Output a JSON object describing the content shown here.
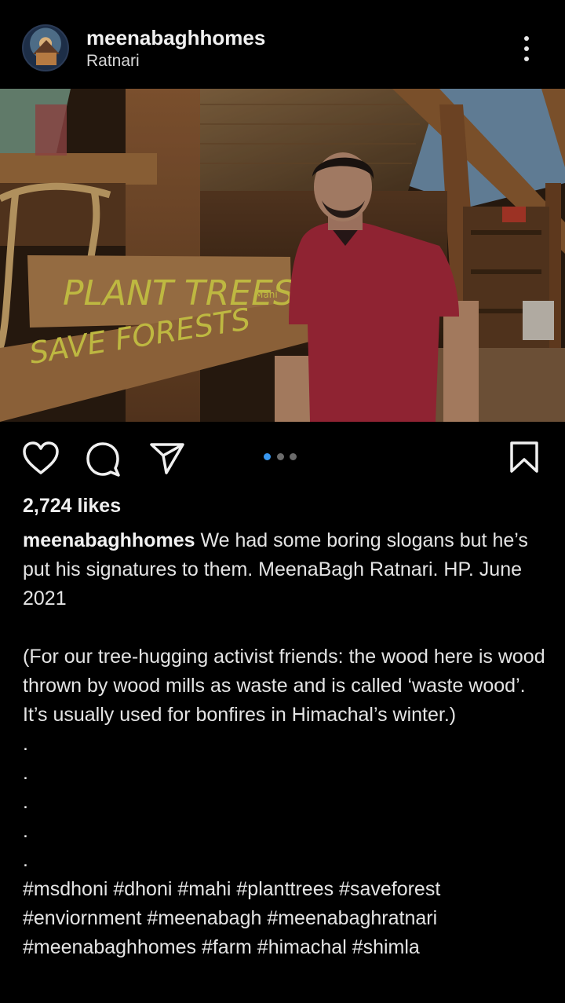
{
  "header": {
    "username": "meenabaghhomes",
    "location": "Ratnari"
  },
  "photo": {
    "sign_line1": "PLANT TREES",
    "sign_line2": "SAVE FORESTS",
    "signature": "Mahi"
  },
  "actions": {
    "like_icon": "heart-icon",
    "comment_icon": "comment-icon",
    "share_icon": "send-icon",
    "save_icon": "bookmark-icon",
    "carousel_count": 3,
    "carousel_active_index": 0
  },
  "post": {
    "likes": "2,724 likes",
    "caption_user": "meenabaghhomes",
    "caption_line1": " We had  some boring slogans but he’s put his signatures to them. MeenaBagh Ratnari. HP. June 2021",
    "caption_para2": "(For our tree-hugging activist friends: the wood here is wood thrown by wood mills as waste and is called ‘waste wood’. It’s usually used for bonfires in Himachal’s winter.)",
    "dot": ".",
    "hashtags": "#msdhoni #dhoni #mahi #planttrees #saveforest #enviornment #meenabagh #meenabaghratnari #meenabaghhomes #farm #himachal #shimla"
  },
  "colors": {
    "background": "#000000",
    "accent": "#3897f0",
    "sign_text": "#d9d24a"
  }
}
